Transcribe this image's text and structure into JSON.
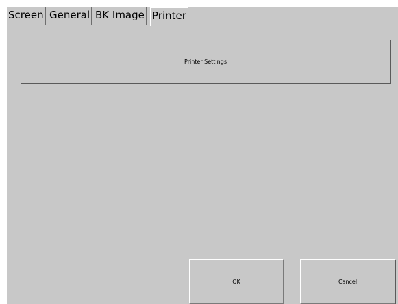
{
  "tabs": [
    {
      "label": "Screen"
    },
    {
      "label": "General"
    },
    {
      "label": "BK Image"
    },
    {
      "label": "Printer",
      "active": true
    }
  ],
  "panel": {
    "printer_settings_label": "Printer Settings"
  },
  "footer": {
    "ok_label": "OK",
    "cancel_label": "Cancel"
  },
  "colors": {
    "dialog_background": "#c8c8c8",
    "page_background": "#ffffff"
  }
}
